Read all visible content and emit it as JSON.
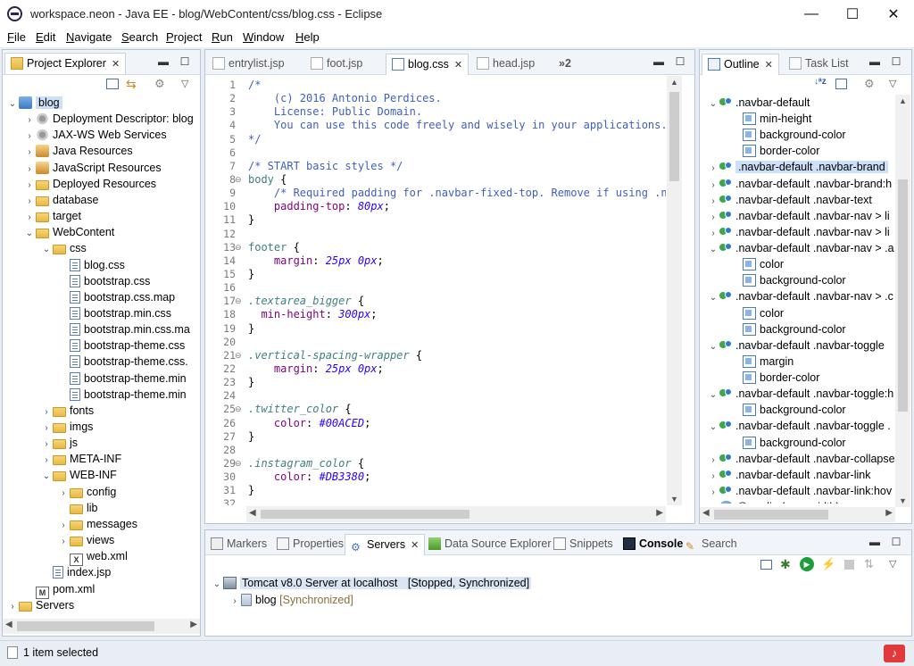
{
  "window": {
    "title": "workspace.neon - Java EE - blog/WebContent/css/blog.css - Eclipse",
    "minimize_glyph": "—",
    "maximize_glyph": "☐",
    "close_glyph": "✕"
  },
  "menubar": {
    "items": [
      {
        "label": "File"
      },
      {
        "label": "Edit"
      },
      {
        "label": "Navigate"
      },
      {
        "label": "Search"
      },
      {
        "label": "Project"
      },
      {
        "label": "Run"
      },
      {
        "label": "Window"
      },
      {
        "label": "Help"
      }
    ]
  },
  "project_explorer": {
    "tab_label": "Project Explorer",
    "tree": [
      {
        "label": "blog",
        "icon": "project-icon",
        "depth": 0,
        "expanded": true,
        "selected": true
      },
      {
        "label": "Deployment Descriptor: blog",
        "icon": "descriptor-icon",
        "depth": 1,
        "expanded": false
      },
      {
        "label": "JAX-WS Web Services",
        "icon": "webservice-icon",
        "depth": 1,
        "expanded": false
      },
      {
        "label": "Java Resources",
        "icon": "java-resources-icon",
        "depth": 1,
        "expanded": false
      },
      {
        "label": "JavaScript Resources",
        "icon": "js-resources-icon",
        "depth": 1,
        "expanded": false
      },
      {
        "label": "Deployed Resources",
        "icon": "folder-icon",
        "depth": 1,
        "expanded": false
      },
      {
        "label": "database",
        "icon": "folder-icon",
        "depth": 1,
        "expanded": false
      },
      {
        "label": "target",
        "icon": "folder-icon",
        "depth": 1,
        "expanded": false
      },
      {
        "label": "WebContent",
        "icon": "folder-icon",
        "depth": 1,
        "expanded": true
      },
      {
        "label": "css",
        "icon": "folder-icon",
        "depth": 2,
        "expanded": true
      },
      {
        "label": "blog.css",
        "icon": "css-file-icon",
        "depth": 3
      },
      {
        "label": "bootstrap.css",
        "icon": "css-file-icon",
        "depth": 3
      },
      {
        "label": "bootstrap.css.map",
        "icon": "css-file-icon",
        "depth": 3
      },
      {
        "label": "bootstrap.min.css",
        "icon": "css-file-icon",
        "depth": 3
      },
      {
        "label": "bootstrap.min.css.ma",
        "icon": "css-file-icon",
        "depth": 3
      },
      {
        "label": "bootstrap-theme.css",
        "icon": "css-file-icon",
        "depth": 3
      },
      {
        "label": "bootstrap-theme.css.",
        "icon": "css-file-icon",
        "depth": 3
      },
      {
        "label": "bootstrap-theme.min",
        "icon": "css-file-icon",
        "depth": 3
      },
      {
        "label": "bootstrap-theme.min",
        "icon": "css-file-icon",
        "depth": 3
      },
      {
        "label": "fonts",
        "icon": "folder-icon",
        "depth": 2,
        "expanded": false
      },
      {
        "label": "imgs",
        "icon": "folder-icon",
        "depth": 2,
        "expanded": false
      },
      {
        "label": "js",
        "icon": "folder-icon",
        "depth": 2,
        "expanded": false
      },
      {
        "label": "META-INF",
        "icon": "folder-icon",
        "depth": 2,
        "expanded": false
      },
      {
        "label": "WEB-INF",
        "icon": "folder-icon",
        "depth": 2,
        "expanded": true
      },
      {
        "label": "config",
        "icon": "folder-icon",
        "depth": 3,
        "expanded": false
      },
      {
        "label": "lib",
        "icon": "folder-icon",
        "depth": 3
      },
      {
        "label": "messages",
        "icon": "folder-icon",
        "depth": 3,
        "expanded": false
      },
      {
        "label": "views",
        "icon": "folder-icon",
        "depth": 3,
        "expanded": false
      },
      {
        "label": "web.xml",
        "icon": "xml-file-icon",
        "depth": 3
      },
      {
        "label": "index.jsp",
        "icon": "jsp-file-icon",
        "depth": 2
      },
      {
        "label": "pom.xml",
        "icon": "maven-file-icon",
        "depth": 1
      },
      {
        "label": "Servers",
        "icon": "folder-icon",
        "depth": 0,
        "expanded": false
      }
    ]
  },
  "editor": {
    "tabs": [
      {
        "label": "entrylist.jsp",
        "active": false
      },
      {
        "label": "foot.jsp",
        "active": false
      },
      {
        "label": "blog.css",
        "active": true
      },
      {
        "label": "head.jsp",
        "active": false
      }
    ],
    "overflow_label": "»2",
    "lines": [
      {
        "n": "1",
        "fold": "",
        "parts": [
          [
            "cm",
            "/*"
          ]
        ]
      },
      {
        "n": "2",
        "fold": "",
        "parts": [
          [
            "cm",
            "    (c) 2016 Antonio Perdices."
          ]
        ]
      },
      {
        "n": "3",
        "fold": "",
        "parts": [
          [
            "cm",
            "    License: Public Domain."
          ]
        ]
      },
      {
        "n": "4",
        "fold": "",
        "parts": [
          [
            "cm",
            "    You can use this code freely and wisely in your applications."
          ]
        ]
      },
      {
        "n": "5",
        "fold": "",
        "parts": [
          [
            "cm",
            "*/"
          ]
        ]
      },
      {
        "n": "6",
        "fold": "",
        "parts": [
          [
            "",
            ""
          ]
        ]
      },
      {
        "n": "7",
        "fold": "",
        "parts": [
          [
            "cm",
            "/* START basic styles */"
          ]
        ]
      },
      {
        "n": "8",
        "fold": "⊖",
        "parts": [
          [
            "sel-t",
            "body"
          ],
          [
            "",
            " {"
          ]
        ]
      },
      {
        "n": "9",
        "fold": "",
        "parts": [
          [
            "cm",
            "    /* Required padding for .navbar-fixed-top. Remove if using .nav"
          ]
        ]
      },
      {
        "n": "10",
        "fold": "",
        "parts": [
          [
            "pn",
            "    padding-top"
          ],
          [
            "",
            ": "
          ],
          [
            "vl",
            "80px"
          ],
          [
            "",
            ";"
          ]
        ]
      },
      {
        "n": "11",
        "fold": "",
        "parts": [
          [
            "",
            "}"
          ]
        ]
      },
      {
        "n": "12",
        "fold": "",
        "parts": [
          [
            "",
            ""
          ]
        ]
      },
      {
        "n": "13",
        "fold": "⊖",
        "parts": [
          [
            "sel-t",
            "footer"
          ],
          [
            "",
            " {"
          ]
        ]
      },
      {
        "n": "14",
        "fold": "",
        "parts": [
          [
            "pn",
            "    margin"
          ],
          [
            "",
            ": "
          ],
          [
            "vl",
            "25px 0px"
          ],
          [
            "",
            ";"
          ]
        ]
      },
      {
        "n": "15",
        "fold": "",
        "parts": [
          [
            "",
            "}"
          ]
        ]
      },
      {
        "n": "16",
        "fold": "",
        "parts": [
          [
            "",
            ""
          ]
        ]
      },
      {
        "n": "17",
        "fold": "⊖",
        "parts": [
          [
            "selI",
            ".textarea_bigger"
          ],
          [
            "",
            " {"
          ]
        ]
      },
      {
        "n": "18",
        "fold": "",
        "parts": [
          [
            "pn",
            "  min-height"
          ],
          [
            "",
            ": "
          ],
          [
            "vl",
            "300px"
          ],
          [
            "",
            ";"
          ]
        ]
      },
      {
        "n": "19",
        "fold": "",
        "parts": [
          [
            "",
            "}"
          ]
        ]
      },
      {
        "n": "20",
        "fold": "",
        "parts": [
          [
            "",
            ""
          ]
        ]
      },
      {
        "n": "21",
        "fold": "⊖",
        "parts": [
          [
            "selI",
            ".vertical-spacing-wrapper"
          ],
          [
            "",
            " {"
          ]
        ]
      },
      {
        "n": "22",
        "fold": "",
        "parts": [
          [
            "pn",
            "    margin"
          ],
          [
            "",
            ": "
          ],
          [
            "vl",
            "25px 0px"
          ],
          [
            "",
            ";"
          ]
        ]
      },
      {
        "n": "23",
        "fold": "",
        "parts": [
          [
            "",
            "}"
          ]
        ]
      },
      {
        "n": "24",
        "fold": "",
        "parts": [
          [
            "",
            ""
          ]
        ]
      },
      {
        "n": "25",
        "fold": "⊖",
        "parts": [
          [
            "selI",
            ".twitter_color"
          ],
          [
            "",
            " {"
          ]
        ]
      },
      {
        "n": "26",
        "fold": "",
        "parts": [
          [
            "pn",
            "    color"
          ],
          [
            "",
            ": "
          ],
          [
            "vl",
            "#00ACED"
          ],
          [
            "",
            ";"
          ]
        ]
      },
      {
        "n": "27",
        "fold": "",
        "parts": [
          [
            "",
            "}"
          ]
        ]
      },
      {
        "n": "28",
        "fold": "",
        "parts": [
          [
            "",
            ""
          ]
        ]
      },
      {
        "n": "29",
        "fold": "⊖",
        "parts": [
          [
            "selI",
            ".instagram_color"
          ],
          [
            "",
            " {"
          ]
        ]
      },
      {
        "n": "30",
        "fold": "",
        "parts": [
          [
            "pn",
            "    color"
          ],
          [
            "",
            ": "
          ],
          [
            "vl",
            "#DB3380"
          ],
          [
            "",
            ";"
          ]
        ]
      },
      {
        "n": "31",
        "fold": "",
        "parts": [
          [
            "",
            "}"
          ]
        ]
      },
      {
        "n": "32",
        "fold": "",
        "parts": [
          [
            "",
            ""
          ]
        ]
      }
    ]
  },
  "outline": {
    "tabs": [
      {
        "label": "Outline",
        "active": true
      },
      {
        "label": "Task List",
        "active": false
      }
    ],
    "rows": [
      {
        "label": ".navbar-default",
        "depth": 0,
        "twisty": "open",
        "icon": "rule"
      },
      {
        "label": "min-height",
        "depth": 1,
        "icon": "prop"
      },
      {
        "label": "background-color",
        "depth": 1,
        "icon": "prop"
      },
      {
        "label": "border-color",
        "depth": 1,
        "icon": "prop"
      },
      {
        "label": ".navbar-default .navbar-brand",
        "depth": 0,
        "twisty": "closed",
        "icon": "rule",
        "selected": true
      },
      {
        "label": ".navbar-default .navbar-brand:h",
        "depth": 0,
        "twisty": "closed",
        "icon": "rule"
      },
      {
        "label": ".navbar-default .navbar-text",
        "depth": 0,
        "twisty": "closed",
        "icon": "rule"
      },
      {
        "label": ".navbar-default .navbar-nav > li",
        "depth": 0,
        "twisty": "closed",
        "icon": "rule"
      },
      {
        "label": ".navbar-default .navbar-nav > li",
        "depth": 0,
        "twisty": "closed",
        "icon": "rule"
      },
      {
        "label": ".navbar-default .navbar-nav > .a",
        "depth": 0,
        "twisty": "open",
        "icon": "rule"
      },
      {
        "label": "color",
        "depth": 1,
        "icon": "prop"
      },
      {
        "label": "background-color",
        "depth": 1,
        "icon": "prop"
      },
      {
        "label": ".navbar-default .navbar-nav > .c",
        "depth": 0,
        "twisty": "open",
        "icon": "rule"
      },
      {
        "label": "color",
        "depth": 1,
        "icon": "prop"
      },
      {
        "label": "background-color",
        "depth": 1,
        "icon": "prop"
      },
      {
        "label": ".navbar-default .navbar-toggle",
        "depth": 0,
        "twisty": "open",
        "icon": "rule"
      },
      {
        "label": "margin",
        "depth": 1,
        "icon": "prop"
      },
      {
        "label": "border-color",
        "depth": 1,
        "icon": "prop"
      },
      {
        "label": ".navbar-default .navbar-toggle:h",
        "depth": 0,
        "twisty": "open",
        "icon": "rule"
      },
      {
        "label": "background-color",
        "depth": 1,
        "icon": "prop"
      },
      {
        "label": ".navbar-default .navbar-toggle .",
        "depth": 0,
        "twisty": "open",
        "icon": "rule"
      },
      {
        "label": "background-color",
        "depth": 1,
        "icon": "prop"
      },
      {
        "label": ".navbar-default .navbar-collapse",
        "depth": 0,
        "twisty": "closed",
        "icon": "rule"
      },
      {
        "label": ".navbar-default .navbar-link",
        "depth": 0,
        "twisty": "closed",
        "icon": "rule"
      },
      {
        "label": ".navbar-default .navbar-link:hov",
        "depth": 0,
        "twisty": "closed",
        "icon": "rule"
      },
      {
        "label": "@media (max-width)",
        "depth": 0,
        "twisty": "open",
        "icon": "media"
      }
    ]
  },
  "bottom": {
    "tabs": [
      {
        "label": "Markers",
        "active": false
      },
      {
        "label": "Properties",
        "active": false
      },
      {
        "label": "Servers",
        "active": true
      },
      {
        "label": "Data Source Explorer",
        "active": false
      },
      {
        "label": "Snippets",
        "active": false
      },
      {
        "label": "Console",
        "active": false,
        "bold": true
      },
      {
        "label": "Search",
        "active": false
      }
    ],
    "server": {
      "label": "Tomcat v8.0 Server at localhost",
      "state": "[Stopped, Synchronized]",
      "child_label": "blog",
      "child_state": "[Synchronized]"
    }
  },
  "status": {
    "text": "1 item selected"
  },
  "colors": {
    "workbench_bg": "#e9eef5",
    "selection": "#cce0f7",
    "comment": "#3f5fbf",
    "property": "#7f007f",
    "value": "#2a00ff"
  }
}
